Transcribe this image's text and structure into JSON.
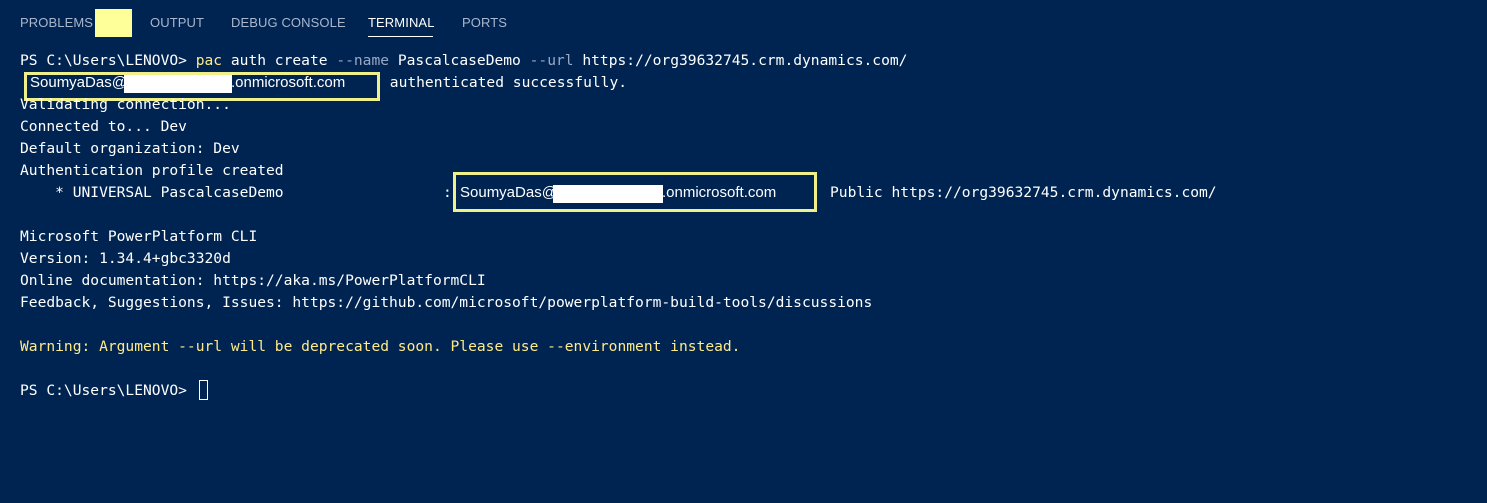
{
  "tabs": [
    {
      "label": "PROBLEMS"
    },
    {
      "label": "OUTPUT"
    },
    {
      "label": "DEBUG CONSOLE"
    },
    {
      "label": "TERMINAL"
    },
    {
      "label": "PORTS"
    }
  ],
  "active_tab": "TERMINAL",
  "terminal": {
    "prompt1": "PS C:\\Users\\LENOVO> ",
    "cmd_pac": "pac",
    "cmd_rest1": " auth create ",
    "flag_name": "--name",
    "arg_name": " PascalcaseDemo ",
    "flag_url": "--url",
    "arg_url": " https://org39632745.crm.dynamics.com/",
    "auth_email_user": "SoumyaDas@",
    "auth_email_domain": ".onmicrosoft.com",
    "auth_suffix": " authenticated successfully.",
    "line_validating": "Validating connection...",
    "line_connected": "Connected to... Dev",
    "line_default_org": "Default organization: Dev",
    "line_profile_created": "Authentication profile created",
    "profile_prefix": "    * UNIVERSAL PascalcaseDemo",
    "profile_colon": ":",
    "profile_email_user": "SoumyaDas@",
    "profile_email_domain": ".onmicrosoft.com",
    "profile_suffix": "Public https://org39632745.crm.dynamics.com/",
    "line_cli": "Microsoft PowerPlatform CLI",
    "line_version": "Version: 1.34.4+gbc3320d",
    "line_docs": "Online documentation: https://aka.ms/PowerPlatformCLI",
    "line_feedback": "Feedback, Suggestions, Issues: https://github.com/microsoft/powerplatform-build-tools/discussions",
    "line_warning": "Warning: Argument --url will be deprecated soon. Please use --environment instead.",
    "prompt2": "PS C:\\Users\\LENOVO> "
  },
  "colors": {
    "background": "#002451",
    "highlight_border": "#f0f08a",
    "warning": "#ffea8a"
  }
}
